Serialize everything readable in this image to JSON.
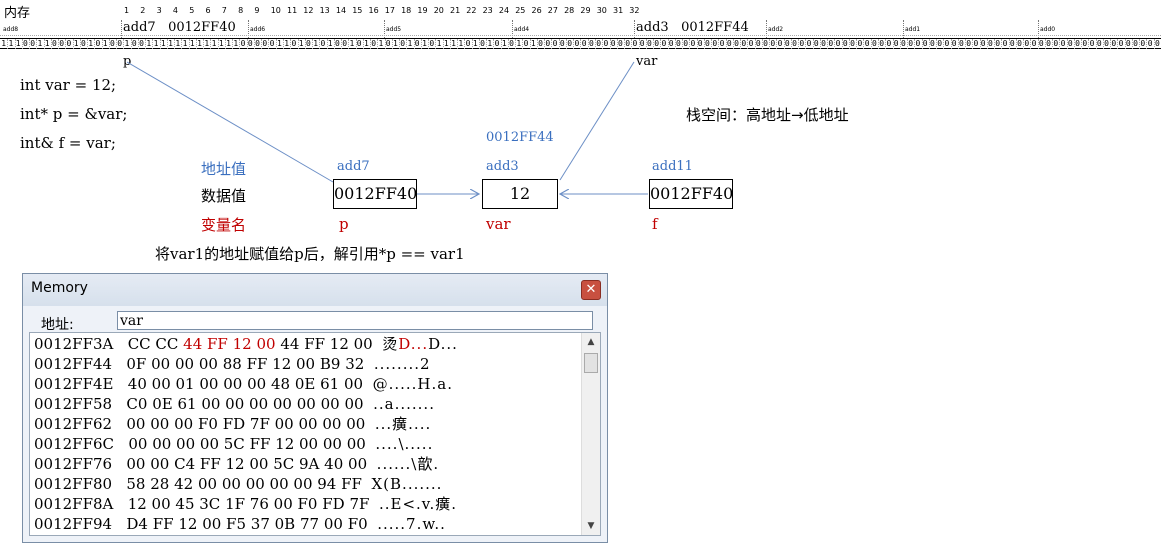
{
  "header": {
    "title": "内存",
    "addr8": "add8",
    "addr7": "add7",
    "addr7_val": "0012FF40",
    "addr6": "add6",
    "addr5": "add5",
    "addr4": "add4",
    "addr3": "add3",
    "addr3_val": "0012FF44",
    "addr2": "add2",
    "addr1": "add1",
    "addr0": "add0",
    "label_p": "p",
    "label_var": "var"
  },
  "ruler": [
    "1",
    "2",
    "3",
    "4",
    "5",
    "6",
    "7",
    "8",
    "9",
    "10",
    "11",
    "12",
    "13",
    "14",
    "15",
    "16",
    "17",
    "18",
    "19",
    "20",
    "21",
    "22",
    "23",
    "24",
    "25",
    "26",
    "27",
    "28",
    "29",
    "30",
    "31",
    "32"
  ],
  "bits": "11100110001010100100111111111111100000110101010010101010101011110101010101000000000000000000000000000000000000000000000000000000000000000000000000000000000000000",
  "code": [
    "int var = 12;",
    "int* p = &var;",
    "int& f = var;"
  ],
  "stack_note": "栈空间：高地址→低地址",
  "diagram": {
    "row_addr_label": "地址值",
    "row_data_label": "数据值",
    "row_name_label": "变量名",
    "top_addr": "0012FF44",
    "cells": [
      {
        "addr": "add7",
        "value": "0012FF40",
        "name": "p"
      },
      {
        "addr": "add3",
        "value": "12",
        "name": "var"
      },
      {
        "addr": "add11",
        "value": "0012FF40",
        "name": "f"
      }
    ],
    "caption": "将var1的地址赋值给p后，解引用*p == var1"
  },
  "memory_window": {
    "title": "Memory",
    "addr_label": "地址:",
    "addr_value": "var",
    "rows": [
      {
        "addr": "0012FF3A",
        "bytes": [
          "CC",
          "CC",
          "44",
          "FF",
          "12",
          "00",
          "44",
          "FF",
          "12",
          "00"
        ],
        "ascii": "烫D...D...",
        "red": [
          2,
          3,
          4,
          5
        ]
      },
      {
        "addr": "0012FF44",
        "bytes": [
          "0F",
          "00",
          "00",
          "00",
          "88",
          "FF",
          "12",
          "00",
          "B9",
          "32"
        ],
        "ascii": "........2",
        "red": []
      },
      {
        "addr": "0012FF4E",
        "bytes": [
          "40",
          "00",
          "01",
          "00",
          "00",
          "00",
          "48",
          "0E",
          "61",
          "00"
        ],
        "ascii": "@.....H.a.",
        "red": []
      },
      {
        "addr": "0012FF58",
        "bytes": [
          "C0",
          "0E",
          "61",
          "00",
          "00",
          "00",
          "00",
          "00",
          "00",
          "00"
        ],
        "ascii": "..a.......",
        "red": []
      },
      {
        "addr": "0012FF62",
        "bytes": [
          "00",
          "00",
          "00",
          "F0",
          "FD",
          "7F",
          "00",
          "00",
          "00",
          "00"
        ],
        "ascii": "...癀....",
        "red": []
      },
      {
        "addr": "0012FF6C",
        "bytes": [
          "00",
          "00",
          "00",
          "00",
          "5C",
          "FF",
          "12",
          "00",
          "00",
          "00"
        ],
        "ascii": "....\\.....",
        "red": []
      },
      {
        "addr": "0012FF76",
        "bytes": [
          "00",
          "00",
          "C4",
          "FF",
          "12",
          "00",
          "5C",
          "9A",
          "40",
          "00"
        ],
        "ascii": "......\\歆.",
        "red": []
      },
      {
        "addr": "0012FF80",
        "bytes": [
          "58",
          "28",
          "42",
          "00",
          "00",
          "00",
          "00",
          "00",
          "94",
          "FF"
        ],
        "ascii": "X(B.......",
        "red": []
      },
      {
        "addr": "0012FF8A",
        "bytes": [
          "12",
          "00",
          "45",
          "3C",
          "1F",
          "76",
          "00",
          "F0",
          "FD",
          "7F"
        ],
        "ascii": "..E<.v.癀.",
        "red": []
      },
      {
        "addr": "0012FF94",
        "bytes": [
          "D4",
          "FF",
          "12",
          "00",
          "F5",
          "37",
          "0B",
          "77",
          "00",
          "F0"
        ],
        "ascii": ".....7.w..",
        "red": []
      }
    ]
  },
  "colors": {
    "blue": "#3a6fbf",
    "red": "#c00000",
    "arrow": "#6c8fc6"
  }
}
